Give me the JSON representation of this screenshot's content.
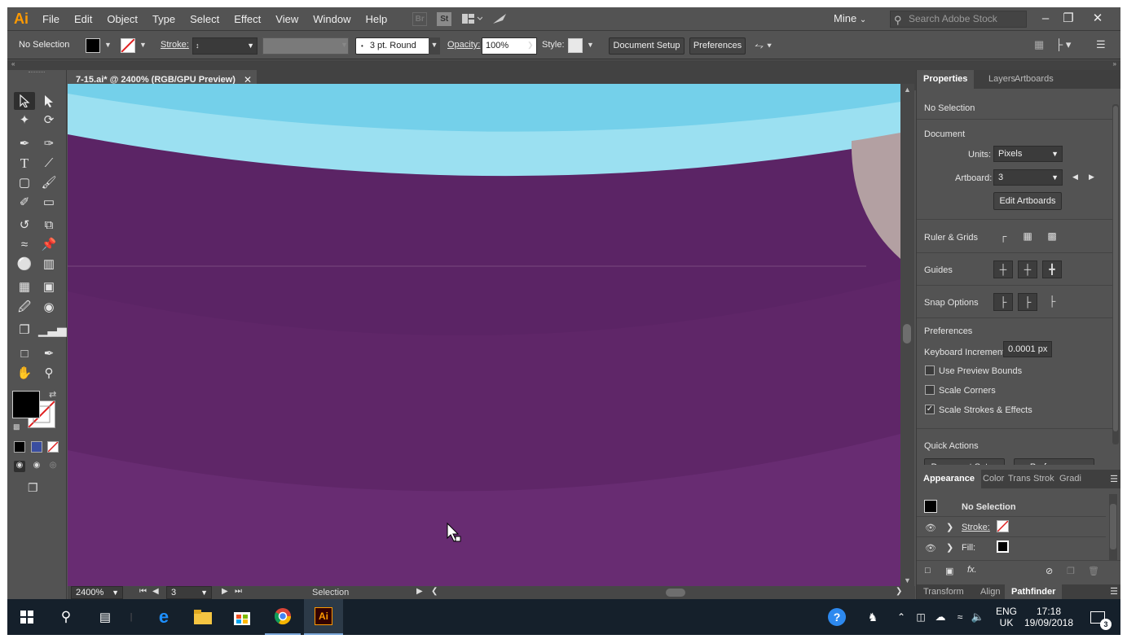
{
  "menubar": {
    "logo": "Ai",
    "items": [
      "File",
      "Edit",
      "Object",
      "Type",
      "Select",
      "Effect",
      "View",
      "Window",
      "Help"
    ],
    "bridge_label": "Br",
    "stock_label": "St",
    "workspace": "Mine",
    "search_placeholder": "Search Adobe Stock"
  },
  "controlbar": {
    "selection": "No Selection",
    "stroke_label": "Stroke:",
    "brush": "3 pt. Round",
    "opacity_label": "Opacity:",
    "opacity_value": "100%",
    "style_label": "Style:",
    "document_setup": "Document Setup",
    "preferences": "Preferences"
  },
  "document": {
    "tab_title": "7-15.ai* @ 2400% (RGB/GPU Preview)",
    "zoom": "2400%",
    "artboard": "3",
    "status": "Selection"
  },
  "properties": {
    "tabs": [
      "Properties",
      "Layers",
      "Artboards"
    ],
    "selection": "No Selection",
    "document_heading": "Document",
    "units_label": "Units:",
    "units_value": "Pixels",
    "artboard_label": "Artboard:",
    "artboard_value": "3",
    "edit_artboards": "Edit Artboards",
    "ruler_grids": "Ruler & Grids",
    "guides": "Guides",
    "snap_options": "Snap Options",
    "preferences_heading": "Preferences",
    "keyboard_increment_label": "Keyboard Increment:",
    "keyboard_increment_value": "0.0001 px",
    "use_preview_bounds": "Use Preview Bounds",
    "use_preview_bounds_checked": false,
    "scale_corners": "Scale Corners",
    "scale_corners_checked": false,
    "scale_strokes": "Scale Strokes & Effects",
    "scale_strokes_checked": true,
    "quick_actions": "Quick Actions",
    "quick_btn1": "Document Setup",
    "quick_btn2": "Preferences"
  },
  "appearance": {
    "tabs": [
      "Appearance",
      "Color",
      "Trans",
      "Strok",
      "Gradi"
    ],
    "title": "No Selection",
    "stroke_label": "Stroke:",
    "fill_label": "Fill:",
    "fx_label": "fx."
  },
  "bottom_tabs": [
    "Transform",
    "Align",
    "Pathfinder"
  ],
  "taskbar": {
    "lang1": "ENG",
    "lang2": "UK",
    "time": "17:18",
    "date": "19/09/2018",
    "notifications": "3"
  },
  "colors": {
    "canvas_purple": "#5b2465",
    "sky_light": "#9be0f1",
    "sky_dark": "#74d0ea",
    "accent_orange": "#ff9a00"
  }
}
